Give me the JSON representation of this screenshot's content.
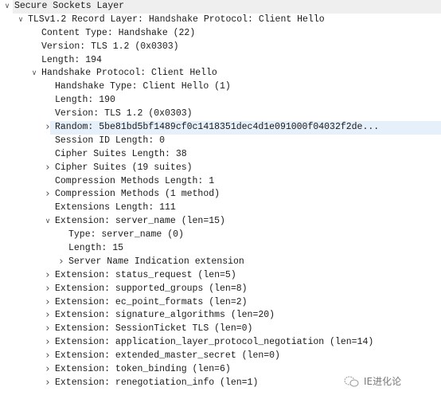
{
  "tree": [
    {
      "level": 0,
      "state": "expanded",
      "text": "Secure Sockets Layer",
      "style": "top"
    },
    {
      "level": 1,
      "state": "expanded",
      "text": "TLSv1.2 Record Layer: Handshake Protocol: Client Hello"
    },
    {
      "level": 2,
      "state": "leaf",
      "text": "Content Type: Handshake (22)"
    },
    {
      "level": 2,
      "state": "leaf",
      "text": "Version: TLS 1.2 (0x0303)"
    },
    {
      "level": 2,
      "state": "leaf",
      "text": "Length: 194"
    },
    {
      "level": 2,
      "state": "expanded",
      "text": "Handshake Protocol: Client Hello"
    },
    {
      "level": 3,
      "state": "leaf",
      "text": "Handshake Type: Client Hello (1)"
    },
    {
      "level": 3,
      "state": "leaf",
      "text": "Length: 190"
    },
    {
      "level": 3,
      "state": "leaf",
      "text": "Version: TLS 1.2 (0x0303)"
    },
    {
      "level": 3,
      "state": "collapsed",
      "text": "Random: 5be81bd5bf1489cf0c1418351dec4d1e091000f04032f2de...",
      "style": "sel"
    },
    {
      "level": 3,
      "state": "leaf",
      "text": "Session ID Length: 0"
    },
    {
      "level": 3,
      "state": "leaf",
      "text": "Cipher Suites Length: 38"
    },
    {
      "level": 3,
      "state": "collapsed",
      "text": "Cipher Suites (19 suites)"
    },
    {
      "level": 3,
      "state": "leaf",
      "text": "Compression Methods Length: 1"
    },
    {
      "level": 3,
      "state": "collapsed",
      "text": "Compression Methods (1 method)"
    },
    {
      "level": 3,
      "state": "leaf",
      "text": "Extensions Length: 111"
    },
    {
      "level": 3,
      "state": "expanded",
      "text": "Extension: server_name (len=15)"
    },
    {
      "level": 4,
      "state": "leaf",
      "text": "Type: server_name (0)"
    },
    {
      "level": 4,
      "state": "leaf",
      "text": "Length: 15"
    },
    {
      "level": 4,
      "state": "collapsed",
      "text": "Server Name Indication extension"
    },
    {
      "level": 3,
      "state": "collapsed",
      "text": "Extension: status_request (len=5)"
    },
    {
      "level": 3,
      "state": "collapsed",
      "text": "Extension: supported_groups (len=8)"
    },
    {
      "level": 3,
      "state": "collapsed",
      "text": "Extension: ec_point_formats (len=2)"
    },
    {
      "level": 3,
      "state": "collapsed",
      "text": "Extension: signature_algorithms (len=20)"
    },
    {
      "level": 3,
      "state": "collapsed",
      "text": "Extension: SessionTicket TLS (len=0)"
    },
    {
      "level": 3,
      "state": "collapsed",
      "text": "Extension: application_layer_protocol_negotiation (len=14)"
    },
    {
      "level": 3,
      "state": "collapsed",
      "text": "Extension: extended_master_secret (len=0)"
    },
    {
      "level": 3,
      "state": "collapsed",
      "text": "Extension: token_binding (len=6)"
    },
    {
      "level": 3,
      "state": "collapsed",
      "text": "Extension: renegotiation_info (len=1)"
    }
  ],
  "icons": {
    "expanded": "chevron-down-icon",
    "collapsed": "chevron-right-icon"
  },
  "watermark": {
    "text": "IE进化论",
    "icon": "wechat-icon"
  },
  "colors": {
    "selected_row": "#e6f0fa",
    "top_row": "#efefef"
  }
}
